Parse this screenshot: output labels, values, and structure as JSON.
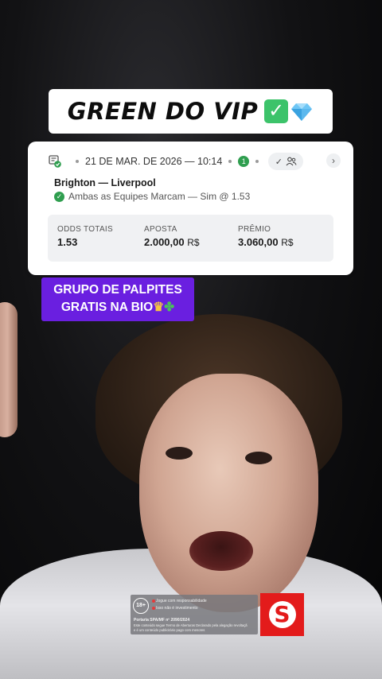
{
  "header": {
    "title": "GREEN DO VIP",
    "check_icon": "white-check-mark-icon",
    "gem_icon": "gem-stone-icon"
  },
  "bet_card": {
    "date": "21 DE MAR. DE 2026 — 10:14",
    "selections_count": "1",
    "match": "Brighton — Liverpool",
    "market": "Ambas as Equipes Marcam — Sim @ 1.53",
    "odds_label": "ODDS TOTAIS",
    "odds_value": "1.53",
    "stake_label": "APOSTA",
    "stake_value": "2.000,00",
    "stake_currency": "R$",
    "prize_label": "PRÊMIO",
    "prize_value": "3.060,00",
    "prize_currency": "R$"
  },
  "promo": {
    "line1": "GRUPO DE PALPITES",
    "line2": "GRATIS NA BIO",
    "emoji_icons": [
      "crown-icon",
      "four-leaf-clover-icon"
    ]
  },
  "disclaimer": {
    "age": "18+",
    "line1": "Jogue com responsabilidade",
    "line2": "Isso não é investimento",
    "line3": "Portaria SPA/MF nº 2090/2024",
    "line4": "Este conteúdo segue Termo de Aberturas Declarado pela alegação revoltaçã",
    "line5": "e é um conteúdo publicitário pago com menores"
  },
  "logo": {
    "letter": "S"
  },
  "colors": {
    "promo_bg": "#6a1fe0",
    "check_green": "#2f9e4f",
    "logo_red": "#e31b1b"
  }
}
